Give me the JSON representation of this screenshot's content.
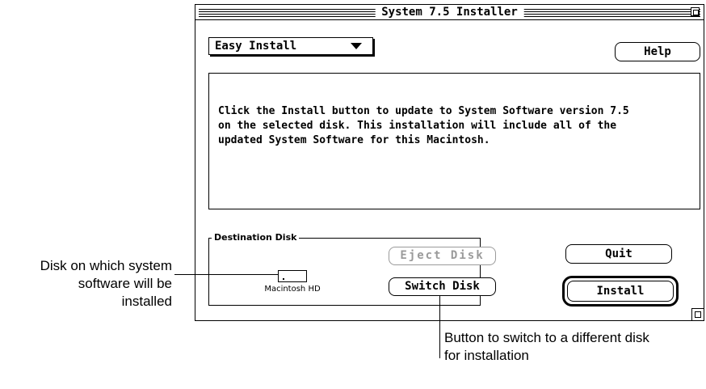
{
  "window": {
    "title": "System 7.5 Installer"
  },
  "popup": {
    "selected": "Easy Install"
  },
  "buttons": {
    "help": "Help",
    "eject_disk": "Eject Disk",
    "switch_disk": "Switch Disk",
    "quit": "Quit",
    "install": "Install"
  },
  "message": {
    "line1": "Click the Install button to update to System Software version 7.5",
    "line2": "on the selected disk.  This installation will include all of the",
    "line3": "updated System Software for this Macintosh."
  },
  "destination": {
    "group_label": "Destination Disk",
    "disk_name": "Macintosh HD"
  },
  "callouts": {
    "disk_line1": "Disk on which system",
    "disk_line2": "software will be",
    "disk_line3": "installed",
    "switch_line1": "Button to switch to a different disk",
    "switch_line2": "for installation"
  }
}
